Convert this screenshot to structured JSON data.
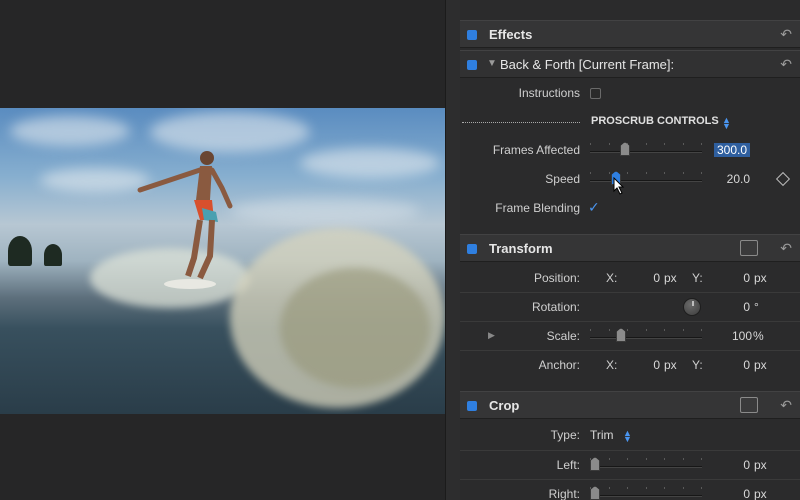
{
  "effects": {
    "title": "Effects",
    "filter_title": "Back & Forth [Current Frame]:",
    "instructions_label": "Instructions",
    "proscrub_label": "PROSCRUB CONTROLS",
    "frames_affected_label": "Frames Affected",
    "frames_affected_value": "300.0",
    "frames_affected_level": 0.25,
    "speed_label": "Speed",
    "speed_value": "20.0",
    "speed_level": 0.2,
    "frame_blending_label": "Frame Blending",
    "frame_blending_checked": true
  },
  "transform": {
    "title": "Transform",
    "position_label": "Position:",
    "position_x": "0",
    "position_y": "0",
    "x_label": "X:",
    "y_label": "Y:",
    "unit_px": "px",
    "rotation_label": "Rotation:",
    "rotation_value": "0",
    "rotation_unit": "°",
    "scale_label": "Scale:",
    "scale_value": "100",
    "scale_unit": "%",
    "anchor_label": "Anchor:",
    "anchor_x": "0",
    "anchor_y": "0"
  },
  "crop": {
    "title": "Crop",
    "type_label": "Type:",
    "type_value": "Trim",
    "left_label": "Left:",
    "left_value": "0",
    "right_label": "Right:",
    "right_value": "0",
    "unit_px": "px"
  },
  "icons": {
    "reset": "reset-arrow-icon",
    "transform_tool": "transform-onscreen-icon",
    "crop_tool": "crop-onscreen-icon",
    "keyframe": "keyframe-diamond-icon"
  },
  "colors": {
    "accent": "#2f7fe0",
    "panel": "#2b2b2c",
    "header": "#353536"
  }
}
